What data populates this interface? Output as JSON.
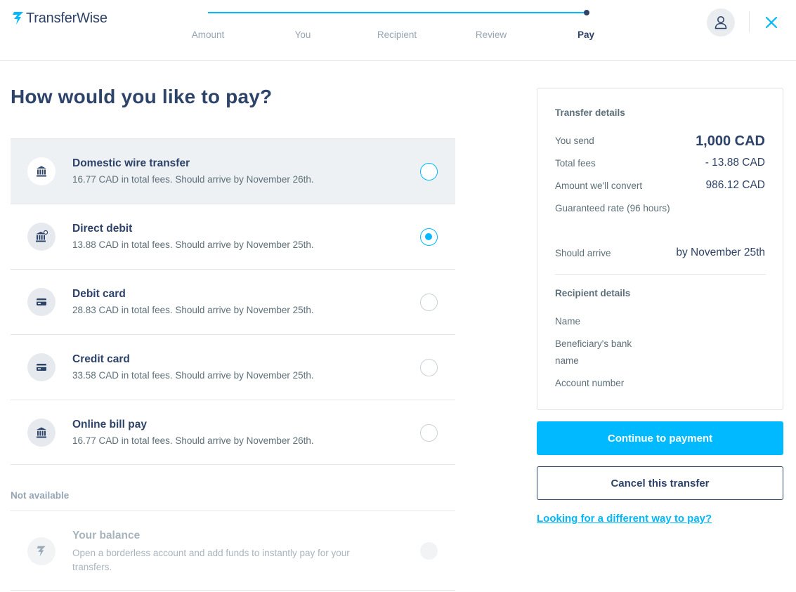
{
  "app": {
    "logo_text": "TransferWise",
    "logo_icon": "transferwise-flag-icon"
  },
  "colors": {
    "accent": "#00b9ff",
    "navy": "#2e4369",
    "muted": "#5d7079"
  },
  "stepper": {
    "progress": 1.0,
    "steps": [
      {
        "label": "Amount"
      },
      {
        "label": "You"
      },
      {
        "label": "Recipient"
      },
      {
        "label": "Review"
      },
      {
        "label": "Pay"
      }
    ]
  },
  "header": {
    "profile_icon": "user-icon",
    "close_icon": "close-icon"
  },
  "main": {
    "title": "How would you like to pay?",
    "options": [
      {
        "title": "Domestic wire transfer",
        "desc": "16.77 CAD in total fees. Should arrive by November 26th.",
        "icon": "bank-icon",
        "selected": false
      },
      {
        "title": "Direct debit",
        "desc": "13.88 CAD in total fees. Should arrive by November 25th.",
        "icon": "bank-debit-icon",
        "selected": true
      },
      {
        "title": "Debit card",
        "desc": "28.83 CAD in total fees. Should arrive by November 25th.",
        "icon": "card-icon",
        "selected": false
      },
      {
        "title": "Credit card",
        "desc": "33.58 CAD in total fees. Should arrive by November 25th.",
        "icon": "card-icon",
        "selected": false
      },
      {
        "title": "Online bill pay",
        "desc": "16.77 CAD in total fees. Should arrive by November 26th.",
        "icon": "bank-icon",
        "selected": false
      }
    ],
    "not_available_label": "Not available",
    "unavailable": {
      "title": "Your balance",
      "desc": "Open a borderless account and add funds to instantly pay for your transfers.",
      "icon": "transferwise-flag-icon"
    }
  },
  "details": {
    "transfer_title": "Transfer details",
    "you_send_label": "You send",
    "you_send_value": "1,000 CAD",
    "fees_label": "Total fees",
    "fees_value": "- 13.88 CAD",
    "convert_label": "Amount we'll convert",
    "convert_value": "986.12 CAD",
    "rate_label": "Guaranteed rate (96 hours)",
    "arrive_label": "Should arrive",
    "arrive_value": "by November 25th",
    "recipient_title": "Recipient details",
    "name_label": "Name",
    "bank_label_1": "Beneficiary's bank",
    "bank_label_2": "name",
    "account_label": "Account number"
  },
  "actions": {
    "continue_label": "Continue to payment",
    "cancel_label": "Cancel this transfer",
    "alt_link": "Looking for a different way to pay?"
  }
}
